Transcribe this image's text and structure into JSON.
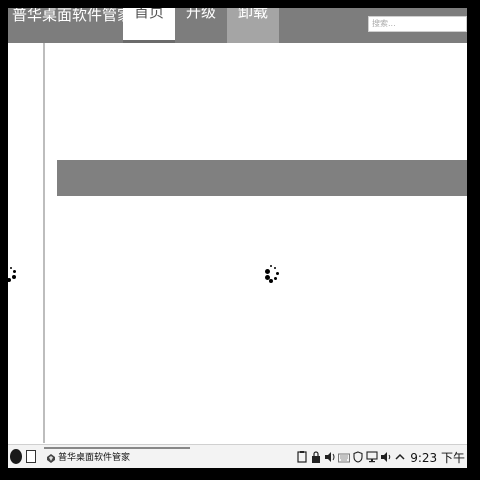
{
  "header": {
    "app_title": "普华桌面软件管家",
    "tabs": [
      {
        "label": "首页"
      },
      {
        "label": "升级"
      },
      {
        "label": "卸载"
      }
    ],
    "search_placeholder": "搜索..."
  },
  "taskbar": {
    "task_label": "普华桌面软件管家",
    "clock": "9:23 下午",
    "tray_icons": [
      "clipboard-icon",
      "lock-icon",
      "volume-icon",
      "keyboard-icon",
      "shield-icon",
      "network-icon",
      "speaker-icon",
      "chevron-up-icon"
    ]
  },
  "colors": {
    "header_bg": "#7d7d7d",
    "active_tab_bg": "#ffffff",
    "uninstall_tab_bg": "#a5a5a5",
    "banner_bg": "#808080"
  }
}
